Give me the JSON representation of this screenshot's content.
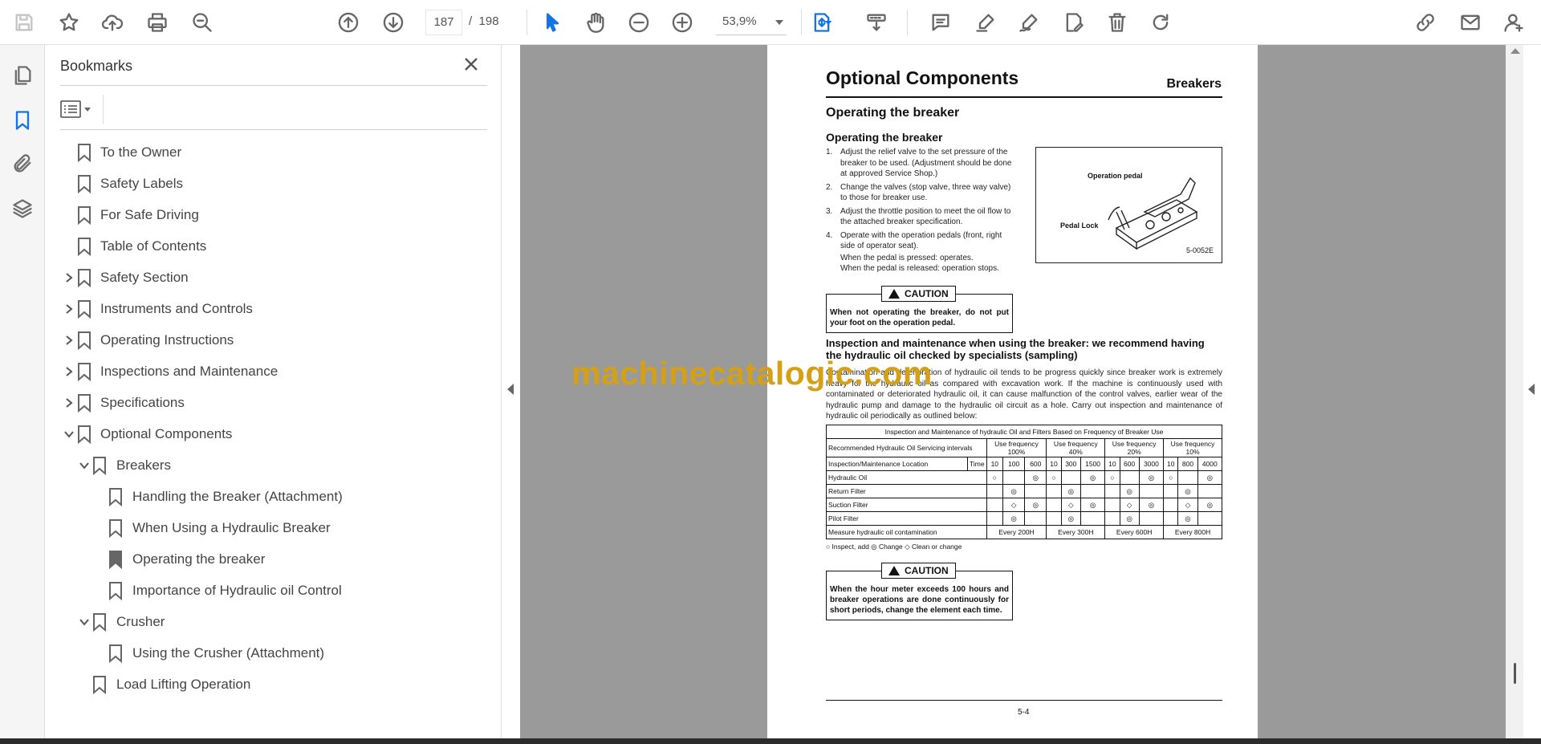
{
  "toolbar": {
    "page_current": "187",
    "page_sep": "/",
    "page_total": "198",
    "zoom": "53,9%"
  },
  "icons": {
    "save": "save-icon",
    "bookmark_star": "star-icon",
    "upload": "upload-cloud-icon",
    "print": "print-icon",
    "find": "zoom-search-icon",
    "prev": "arrow-up-circle-icon",
    "next": "arrow-down-circle-icon",
    "select": "cursor-arrow-icon",
    "hand": "hand-icon",
    "zoom_out": "minus-circle-icon",
    "zoom_in": "plus-circle-icon",
    "fit": "fit-page-icon",
    "scroll_mode": "scroll-mode-icon",
    "comment": "comment-icon",
    "highlight": "highlighter-icon",
    "sign": "pen-sign-icon",
    "fill": "fill-sign-icon",
    "delete": "trash-icon",
    "rotate": "rotate-icon",
    "share": "share-link-icon",
    "email": "mail-icon",
    "account": "account-icon"
  },
  "rail": [
    "pages-icon",
    "bookmarks-icon",
    "attachments-icon",
    "layers-icon"
  ],
  "bookmarks": {
    "title": "Bookmarks",
    "items": [
      {
        "label": "To the Owner",
        "level": 0,
        "expander": "none"
      },
      {
        "label": "Safety Labels",
        "level": 0,
        "expander": "none"
      },
      {
        "label": "For Safe Driving",
        "level": 0,
        "expander": "none"
      },
      {
        "label": "Table of Contents",
        "level": 0,
        "expander": "none"
      },
      {
        "label": "Safety Section",
        "level": 0,
        "expander": "collapsed"
      },
      {
        "label": "Instruments and Controls",
        "level": 0,
        "expander": "collapsed"
      },
      {
        "label": "Operating Instructions",
        "level": 0,
        "expander": "collapsed"
      },
      {
        "label": "Inspections and Maintenance",
        "level": 0,
        "expander": "collapsed"
      },
      {
        "label": "Specifications",
        "level": 0,
        "expander": "collapsed"
      },
      {
        "label": "Optional Components",
        "level": 0,
        "expander": "expanded"
      },
      {
        "label": "Breakers",
        "level": 1,
        "expander": "expanded"
      },
      {
        "label": "Handling the Breaker (Attachment)",
        "level": 2,
        "expander": "none"
      },
      {
        "label": "When Using a Hydraulic Breaker",
        "level": 2,
        "expander": "none"
      },
      {
        "label": "Operating the breaker",
        "level": 2,
        "expander": "none",
        "selected": true
      },
      {
        "label": "Importance of Hydraulic oil Control",
        "level": 2,
        "expander": "none"
      },
      {
        "label": "Crusher",
        "level": 1,
        "expander": "expanded"
      },
      {
        "label": "Using the Crusher (Attachment)",
        "level": 2,
        "expander": "none"
      },
      {
        "label": "Load Lifting Operation",
        "level": 1,
        "expander": "none"
      }
    ]
  },
  "page": {
    "title": "Optional Components",
    "section": "Breakers",
    "heading": "Operating the breaker",
    "subheading": "Operating the breaker",
    "steps": [
      {
        "n": "1.",
        "text": "Adjust the relief valve to the set pressure of the breaker to be used. (Adjustment should be done at approved Service Shop.)"
      },
      {
        "n": "2.",
        "text": "Change the valves (stop valve, three way valve) to those for breaker use."
      },
      {
        "n": "3.",
        "text": "Adjust the throttle position to meet the oil flow to the attached breaker specification."
      },
      {
        "n": "4.",
        "text": "Operate with the operation pedals (front, right side of operator seat)."
      }
    ],
    "step_sub1": "When the pedal is pressed: operates.",
    "step_sub2": "When the pedal is released: operation stops.",
    "figure": {
      "label_pedal": "Operation pedal",
      "label_lock": "Pedal Lock",
      "code": "5-0052E"
    },
    "caution1": {
      "title": "CAUTION",
      "text": "When not operating the breaker, do not put your foot on the operation pedal."
    },
    "heading2": "Inspection and maintenance when using the breaker: we recommend having the hydraulic oil checked by specialists (sampling)",
    "para": "Contamination and deterioration of hydraulic oil tends to be progress quickly since breaker work is extremely heavy for the hydraulic oil as compared with excavation work. If the machine is continuously used with contaminated or deteriorated hydraulic oil, it can cause malfunction of the control valves, earlier wear of the hydraulic pump and damage to the hydraulic oil circuit as a hole. Carry out inspection and maintenance of hydraulic oil periodically as outlined below:",
    "table": {
      "caption": "Inspection and Maintenance of hydraulic Oil and Filters Based on Frequency of Breaker Use",
      "rec_label": "Recommended Hydraulic Oil Servicing intervals",
      "loc_label": "Inspection/Maintenance Location",
      "time_label": "Time",
      "freq": [
        "Use frequency 100%",
        "Use frequency 40%",
        "Use frequency 20%",
        "Use frequency 10%"
      ],
      "hours": [
        "10",
        "100",
        "600",
        "10",
        "300",
        "1500",
        "10",
        "600",
        "3000",
        "10",
        "800",
        "4000"
      ],
      "rows": [
        {
          "name": "Hydraulic Oil",
          "cells": [
            "○",
            "",
            "◎",
            "○",
            "",
            "◎",
            "○",
            "",
            "◎",
            "○",
            "",
            "◎"
          ]
        },
        {
          "name": "Return Filter",
          "cells": [
            "",
            "◎",
            "",
            "",
            "◎",
            "",
            "",
            "◎",
            "",
            "",
            "◎",
            ""
          ]
        },
        {
          "name": "Suction Filter",
          "cells": [
            "",
            "◇",
            "◎",
            "",
            "◇",
            "◎",
            "",
            "◇",
            "◎",
            "",
            "◇",
            "◎"
          ]
        },
        {
          "name": "Pilot Filter",
          "cells": [
            "",
            "◎",
            "",
            "",
            "◎",
            "",
            "",
            "◎",
            "",
            "",
            "◎",
            ""
          ]
        }
      ],
      "measure_label": "Measure hydraulic oil contamination",
      "measure": [
        "Every 200H",
        "Every 300H",
        "Every 600H",
        "Every 800H"
      ]
    },
    "legend": "○ Inspect, add    ◎ Change    ◇ Clean or change",
    "caution2": {
      "title": "CAUTION",
      "text": "When the hour meter exceeds 100 hours and breaker operations are done continuously for short periods, change the element each time."
    },
    "page_number": "5-4"
  },
  "watermark": "machinecatalogic.com"
}
